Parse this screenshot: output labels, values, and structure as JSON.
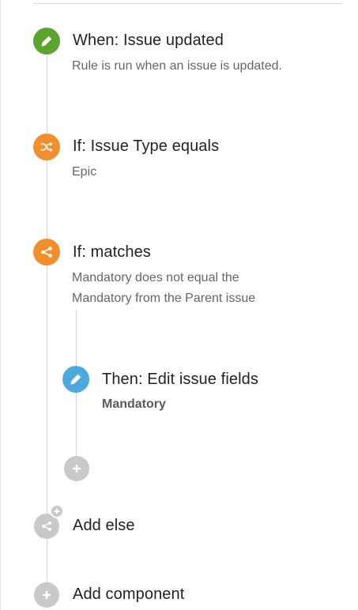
{
  "steps": [
    {
      "title": "When: Issue updated",
      "description": "Rule is run when an issue is updated."
    },
    {
      "title": "If: Issue Type equals",
      "description": "Epic"
    },
    {
      "title": "If: matches",
      "description_line1": "Mandatory does not equal the",
      "description_line2": "Mandatory from the Parent issue"
    },
    {
      "title": "Then: Edit issue fields",
      "description": "Mandatory"
    }
  ],
  "actions": {
    "add_else": "Add else",
    "add_component": "Add component"
  },
  "colors": {
    "trigger_green": "#5ca32f",
    "condition_orange": "#f18f2c",
    "action_blue": "#4ea9df",
    "add_gray": "#c9c9c9"
  },
  "icons": {
    "trigger": "pencil-icon",
    "issue_type_condition": "shuffle-icon",
    "match_condition": "branch-icon",
    "action": "pencil-icon",
    "add_nested": "plus-icon",
    "add_else": "branch-icon",
    "add_component": "plus-icon"
  }
}
